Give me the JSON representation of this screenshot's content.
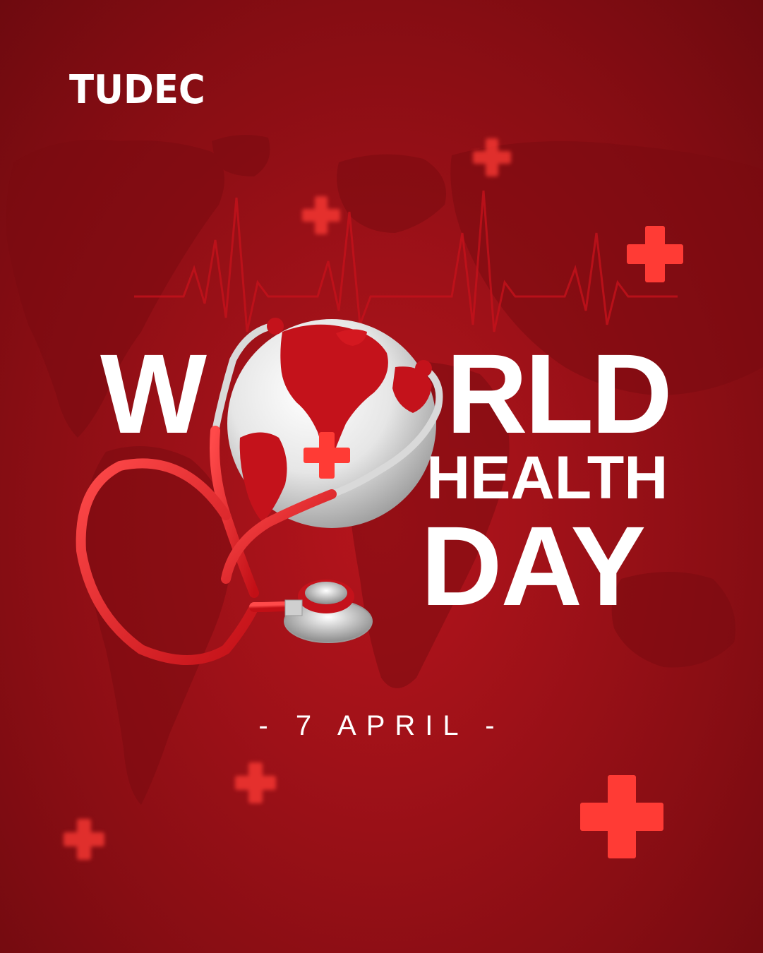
{
  "brand": {
    "logo_text": "TUDEC"
  },
  "headline": {
    "letter_w": "W",
    "letters_rld": "RLD",
    "health": "HEALTH",
    "day": "DAY"
  },
  "date": {
    "label": "- 7 APRIL -"
  },
  "colors": {
    "background": "#9e1118",
    "accent_red": "#ff3b35",
    "text": "#ffffff"
  },
  "icons": [
    "medical-cross-icon",
    "globe-icon",
    "stethoscope-icon",
    "world-map-icon",
    "heartbeat-icon"
  ]
}
